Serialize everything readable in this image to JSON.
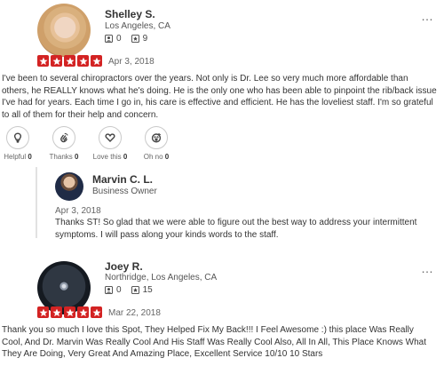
{
  "reviews": [
    {
      "name": "Shelley S.",
      "location": "Los Angeles, CA",
      "friends": "0",
      "reviews": "9",
      "rating": 5,
      "date": "Apr 3, 2018",
      "text": "I've been to several chiropractors over the years. Not only is Dr. Lee so very much more affordable than others, he REALLY knows what he's doing. He is the only one who has been able to pinpoint the rib/back issue I've had for years. Each time I go in, his care is effective and efficient. He has the loveliest staff. I'm so grateful to all of them for their help and concern.",
      "reactions": [
        {
          "label": "Helpful",
          "count": "0",
          "icon": "lightbulb-icon"
        },
        {
          "label": "Thanks",
          "count": "0",
          "icon": "clapping-hands-icon"
        },
        {
          "label": "Love this",
          "count": "0",
          "icon": "heart-icon"
        },
        {
          "label": "Oh no",
          "count": "0",
          "icon": "surprised-face-icon"
        }
      ],
      "owner_reply": {
        "name": "Marvin C. L.",
        "role": "Business Owner",
        "date": "Apr 3, 2018",
        "text": "Thanks ST! So glad that we were able to figure out the best way to address your intermittent symptoms. I will pass along your kinds words to the staff."
      }
    },
    {
      "name": "Joey R.",
      "location": "Northridge, Los Angeles, CA",
      "friends": "0",
      "reviews": "15",
      "rating": 5,
      "date": "Mar 22, 2018",
      "text": "Thank you so much I love this Spot, They Helped Fix My Back!!! I Feel Awesome :) this place Was Really Cool, And Dr. Marvin Was Really Cool And His Staff Was Really Cool Also, All In All, This Place Knows What They Are Doing, Very Great And Amazing Place, Excellent Service 10/10 10 Stars"
    }
  ],
  "menu_glyph": "…"
}
